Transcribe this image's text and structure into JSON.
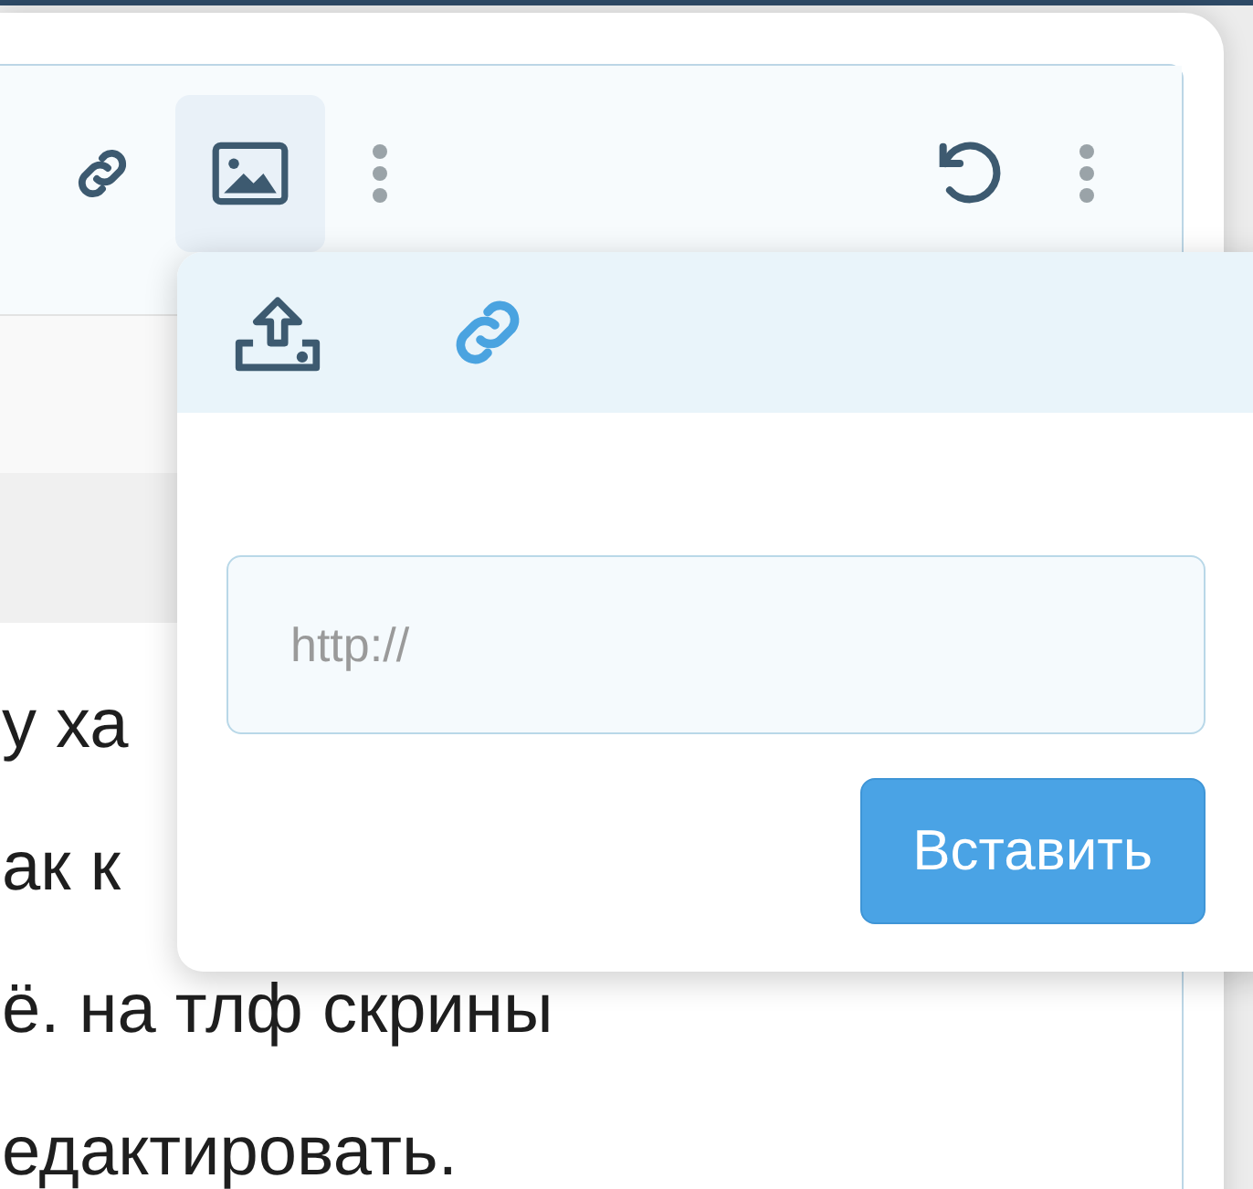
{
  "toolbar": {
    "items": [
      {
        "kind": "link",
        "selected": false
      },
      {
        "kind": "image",
        "selected": true
      },
      {
        "kind": "more",
        "selected": false
      },
      {
        "kind": "undo",
        "selected": false
      },
      {
        "kind": "more",
        "selected": false
      }
    ]
  },
  "content": {
    "lines": [
      "у ха",
      "ак к",
      "ё. на тлф скрины",
      "едактировать."
    ]
  },
  "popup": {
    "tabs": [
      {
        "kind": "upload",
        "selected": false
      },
      {
        "kind": "link",
        "selected": true
      }
    ],
    "url_field": {
      "placeholder": "http://"
    },
    "insert_button": "Вставить"
  }
}
